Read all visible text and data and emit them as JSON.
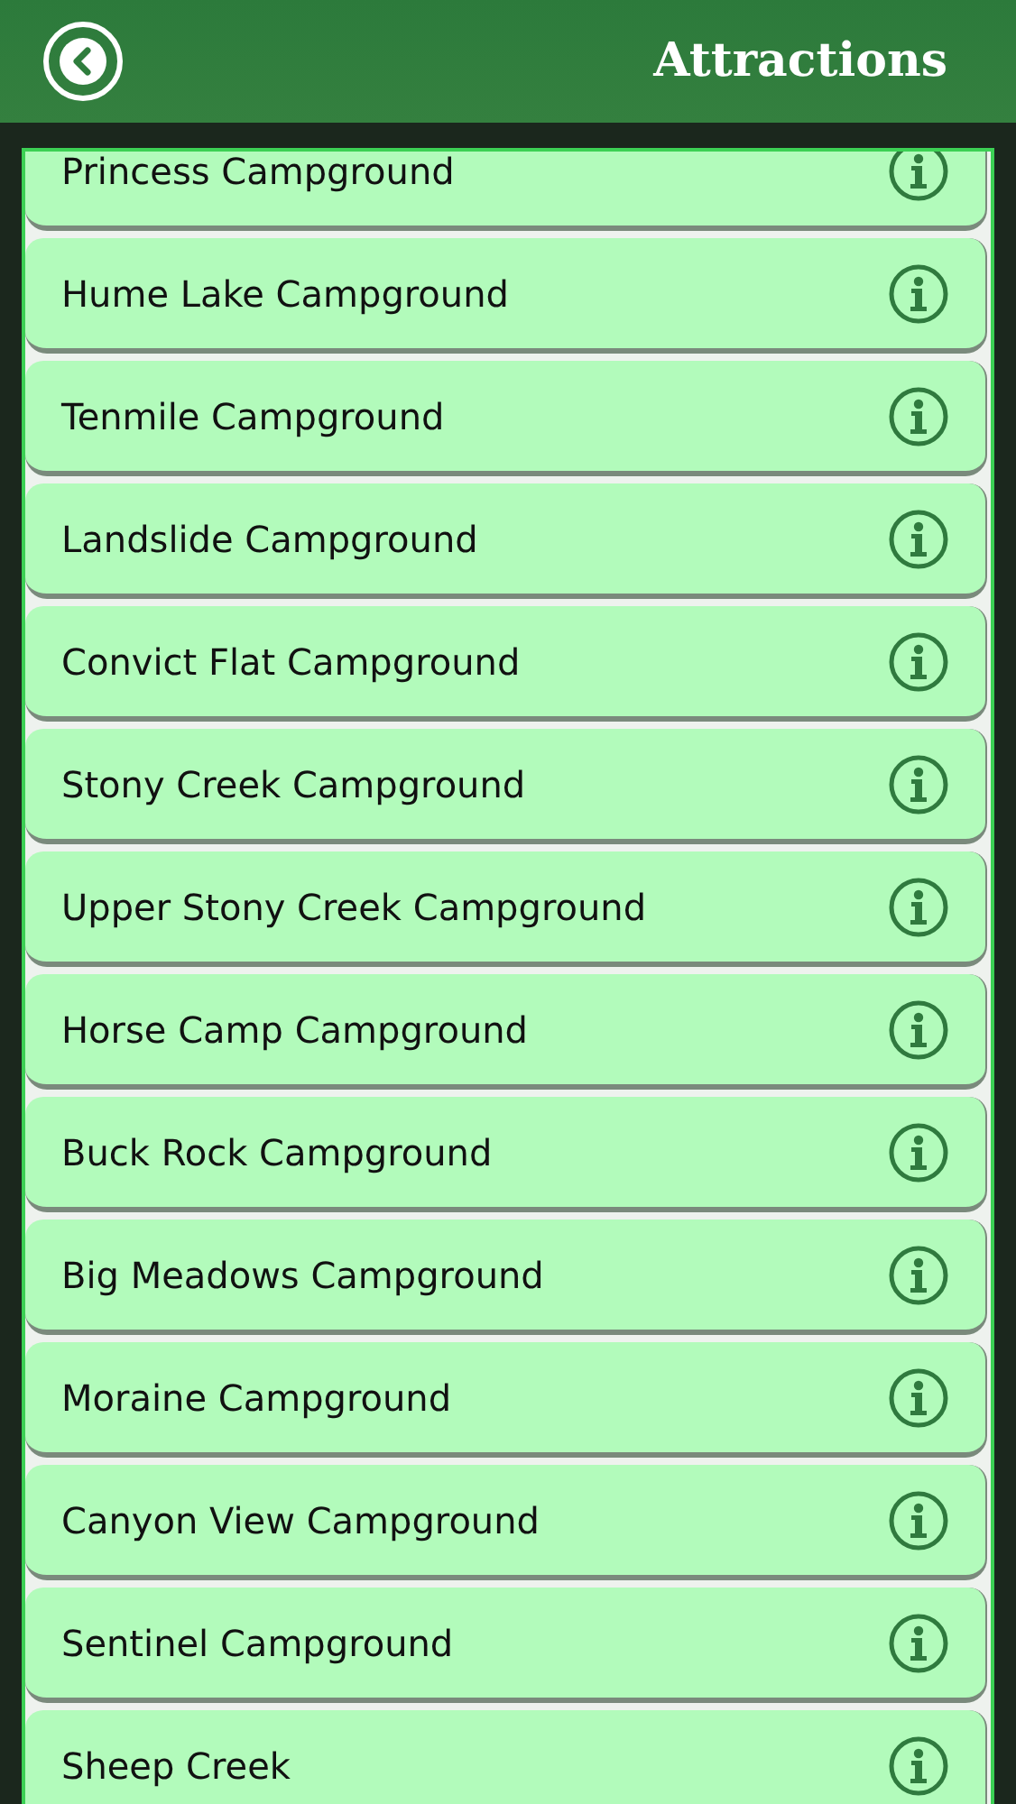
{
  "header": {
    "title": "Attractions"
  },
  "list": {
    "items": [
      {
        "label": "Princess Campground"
      },
      {
        "label": "Hume Lake Campground"
      },
      {
        "label": "Tenmile Campground"
      },
      {
        "label": "Landslide Campground"
      },
      {
        "label": "Convict Flat Campground"
      },
      {
        "label": "Stony Creek Campground"
      },
      {
        "label": "Upper Stony Creek Campground"
      },
      {
        "label": "Horse Camp Campground"
      },
      {
        "label": "Buck Rock Campground"
      },
      {
        "label": "Big Meadows Campground"
      },
      {
        "label": "Moraine Campground"
      },
      {
        "label": "Canyon View Campground"
      },
      {
        "label": "Sentinel Campground"
      },
      {
        "label": "Sheep Creek"
      }
    ]
  }
}
